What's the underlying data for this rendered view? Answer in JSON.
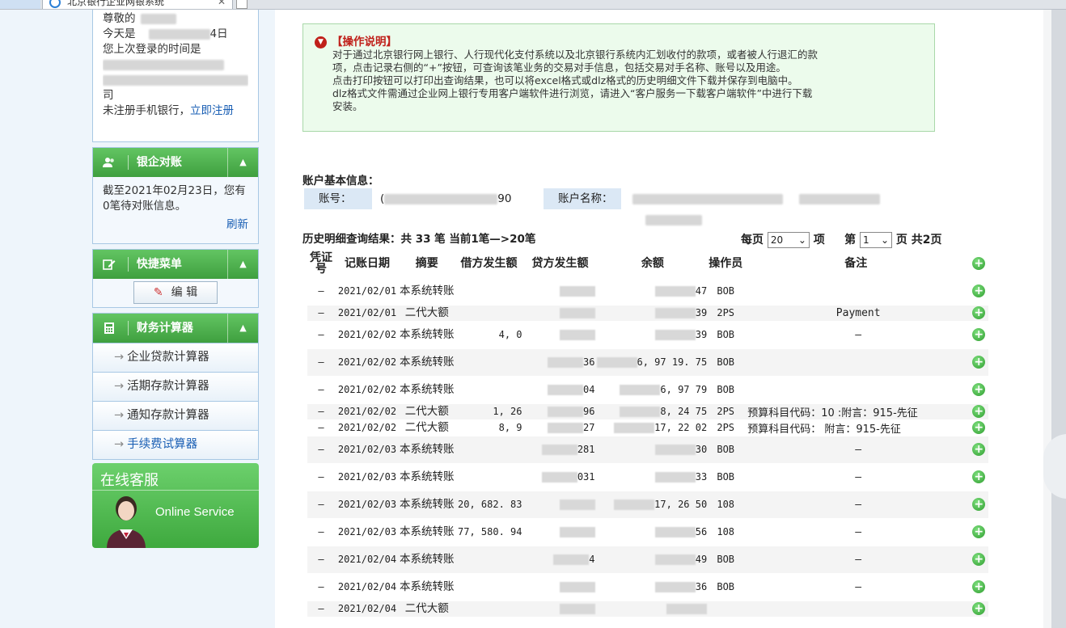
{
  "browser": {
    "tab_title": "北京银行企业网银系统"
  },
  "login": {
    "greeting": "尊敬的",
    "today_prefix": "今天是",
    "today_suffix": "4日",
    "last_login": "您上次登录的时间是",
    "company_suffix": "司",
    "mobile_text": "未注册手机银行，",
    "register_link": "立即注册"
  },
  "reconcile": {
    "title": "银企对账",
    "text": "截至2021年02月23日，您有0笔待对账信息。",
    "refresh": "刷新"
  },
  "shortcut": {
    "title": "快捷菜单",
    "edit": "编 辑"
  },
  "calculator": {
    "title": "财务计算器",
    "items": [
      "企业贷款计算器",
      "活期存款计算器",
      "通知存款计算器",
      "手续费试算器"
    ]
  },
  "service": {
    "title": "在线客服",
    "subtitle": "Online Service"
  },
  "notice": {
    "title": "【操作说明】",
    "lines": [
      "对于通过北京银行网上银行、人行现代化支付系统以及北京银行系统内汇划收付的款项，或者被人行退汇的款",
      "项，点击记录右侧的“+”按钮，可查询该笔业务的交易对手信息，包括交易对手名称、账号以及用途。",
      "点击打印按钮可以打印出查询结果，也可以将excel格式或dlz格式的历史明细文件下载并保存到电脑中。",
      "dlz格式文件需通过企业网上银行专用客户端软件进行浏览，请进入“客户服务一下载客户端软件”中进行下载",
      "安装。"
    ]
  },
  "account": {
    "section_title": "账户基本信息：",
    "no_label": "账号：",
    "no_value_start": "(",
    "no_value_end": "90",
    "name_label": "账户名称："
  },
  "history": {
    "title": "历史明细查询结果：共 33 笔  当前1笔—>20笔",
    "per_page_label": "每页",
    "per_page": "20",
    "unit": "项",
    "page_label": "第",
    "page": "1",
    "page_total": "页 共2页"
  },
  "table": {
    "headers": [
      "凭证号",
      "记账日期",
      "摘要",
      "借方发生额",
      "贷方发生额",
      "余额",
      "操作员",
      "备注"
    ],
    "rows": [
      {
        "pz": "–",
        "date": "2021/02/01",
        "zy": "本系统转账",
        "debit": "",
        "credit": "",
        "balance": "47",
        "op": "BOB",
        "note": ""
      },
      {
        "pz": "–",
        "date": "2021/02/01",
        "zy": "二代大额",
        "debit": "",
        "credit": "",
        "balance": "39",
        "op": "2PS",
        "note": "Payment"
      },
      {
        "pz": "–",
        "date": "2021/02/02",
        "zy": "本系统转账",
        "debit": "4, 0",
        "credit": "",
        "balance": "39",
        "op": "BOB",
        "note": "–"
      },
      {
        "pz": "–",
        "date": "2021/02/02",
        "zy": "本系统转账",
        "debit": "",
        "credit": "36",
        "balance": "6, 97   19. 75",
        "op": "BOB",
        "note": ""
      },
      {
        "pz": "–",
        "date": "2021/02/02",
        "zy": "本系统转账",
        "debit": "",
        "credit": "04",
        "balance": "6, 97   79",
        "op": "BOB",
        "note": ""
      },
      {
        "pz": "–",
        "date": "2021/02/02",
        "zy": "二代大额",
        "debit": "1, 26",
        "credit": "96",
        "balance": "8, 24   75",
        "op": "2PS",
        "note": "预算科目代码：10        :附言：915-先征"
      },
      {
        "pz": "–",
        "date": "2021/02/02",
        "zy": "二代大额",
        "debit": "8, 9",
        "credit": "27",
        "balance": "17, 22   02",
        "op": "2PS",
        "note": "预算科目代码：          附言：915-先征"
      },
      {
        "pz": "–",
        "date": "2021/02/03",
        "zy": "本系统转账",
        "debit": "",
        "credit": "281",
        "balance": "30",
        "op": "BOB",
        "note": "–"
      },
      {
        "pz": "–",
        "date": "2021/02/03",
        "zy": "本系统转账",
        "debit": "",
        "credit": "031",
        "balance": "33",
        "op": "BOB",
        "note": "–"
      },
      {
        "pz": "–",
        "date": "2021/02/03",
        "zy": "本系统转账",
        "debit": "20, 682. 83",
        "credit": "",
        "balance": "17, 26   50",
        "op": "108",
        "note": "–"
      },
      {
        "pz": "–",
        "date": "2021/02/03",
        "zy": "本系统转账",
        "debit": "77, 580. 94",
        "credit": "",
        "balance": "56",
        "op": "108",
        "note": "–"
      },
      {
        "pz": "–",
        "date": "2021/02/04",
        "zy": "本系统转账",
        "debit": "",
        "credit": "4",
        "balance": "49",
        "op": "BOB",
        "note": "–"
      },
      {
        "pz": "–",
        "date": "2021/02/04",
        "zy": "本系统转账",
        "debit": "",
        "credit": "",
        "balance": "36",
        "op": "BOB",
        "note": "–"
      },
      {
        "pz": "–",
        "date": "2021/02/04",
        "zy": "二代大额",
        "debit": "",
        "credit": "",
        "balance": "",
        "op": "",
        "note": ""
      }
    ]
  }
}
